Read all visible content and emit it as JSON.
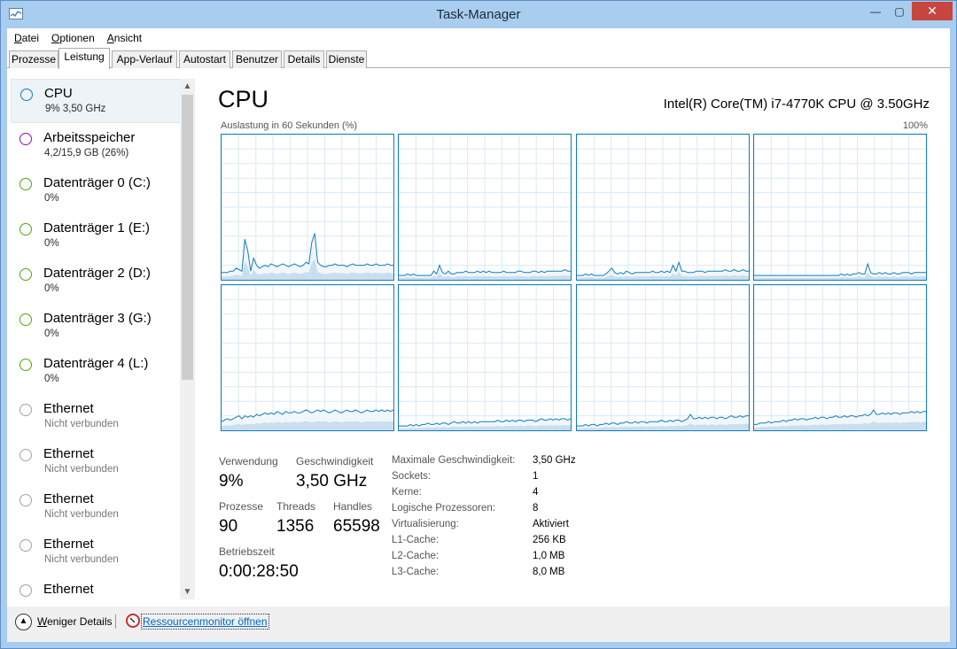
{
  "window": {
    "title": "Task-Manager"
  },
  "window_controls": {
    "minimize": "—",
    "maximize": "▢",
    "close": "✕"
  },
  "menu": [
    {
      "label": "Datei",
      "mnemonic": "D",
      "rest": "atei"
    },
    {
      "label": "Optionen",
      "mnemonic": "O",
      "rest": "ptionen"
    },
    {
      "label": "Ansicht",
      "mnemonic": "A",
      "rest": "nsicht"
    }
  ],
  "tabs": [
    "Prozesse",
    "Leistung",
    "App-Verlauf",
    "Autostart",
    "Benutzer",
    "Details",
    "Dienste"
  ],
  "active_tab": "Leistung",
  "sidebar": {
    "items": [
      {
        "title": "CPU",
        "sub": "9% 3,50 GHz",
        "color": "#117dbb",
        "selected": true
      },
      {
        "title": "Arbeitsspeicher",
        "sub": "4,2/15,9 GB (26%)",
        "color": "#8b12ae",
        "selected": false
      },
      {
        "title": "Datenträger 0 (C:)",
        "sub": "0%",
        "color": "#4da60c",
        "selected": false
      },
      {
        "title": "Datenträger 1 (E:)",
        "sub": "0%",
        "color": "#4da60c",
        "selected": false
      },
      {
        "title": "Datenträger 2 (D:)",
        "sub": "0%",
        "color": "#4da60c",
        "selected": false
      },
      {
        "title": "Datenträger 3 (G:)",
        "sub": "0%",
        "color": "#4da60c",
        "selected": false
      },
      {
        "title": "Datenträger 4 (L:)",
        "sub": "0%",
        "color": "#4da60c",
        "selected": false
      },
      {
        "title": "Ethernet",
        "sub": "Nicht verbunden",
        "color": "#a0a0a0",
        "selected": false
      },
      {
        "title": "Ethernet",
        "sub": "Nicht verbunden",
        "color": "#a0a0a0",
        "selected": false
      },
      {
        "title": "Ethernet",
        "sub": "Nicht verbunden",
        "color": "#a0a0a0",
        "selected": false
      },
      {
        "title": "Ethernet",
        "sub": "Nicht verbunden",
        "color": "#a0a0a0",
        "selected": false
      },
      {
        "title": "Ethernet",
        "sub": "",
        "color": "#a0a0a0",
        "selected": false
      }
    ]
  },
  "main": {
    "title": "CPU",
    "model": "Intel(R) Core(TM) i7-4770K CPU @ 3.50GHz",
    "graph_label": "Auslastung in 60 Sekunden (%)",
    "graph_max": "100%",
    "graph_color": "#117dbb"
  },
  "stats": {
    "usage_label": "Verwendung",
    "usage_value": "9%",
    "speed_label": "Geschwindigkeit",
    "speed_value": "3,50 GHz",
    "processes_label": "Prozesse",
    "processes_value": "90",
    "threads_label": "Threads",
    "threads_value": "1356",
    "handles_label": "Handles",
    "handles_value": "65598",
    "uptime_label": "Betriebszeit",
    "uptime_value": "0:00:28:50"
  },
  "specs": [
    {
      "label": "Maximale Geschwindigkeit:",
      "value": "3,50 GHz"
    },
    {
      "label": "Sockets:",
      "value": "1"
    },
    {
      "label": "Kerne:",
      "value": "4"
    },
    {
      "label": "Logische Prozessoren:",
      "value": "8"
    },
    {
      "label": "Virtualisierung:",
      "value": "Aktiviert"
    },
    {
      "label": "L1-Cache:",
      "value": "256 KB"
    },
    {
      "label": "L2-Cache:",
      "value": "1,0 MB"
    },
    {
      "label": "L3-Cache:",
      "value": "8,0 MB"
    }
  ],
  "footer": {
    "fewer_details": "Weniger Details",
    "fewer_mnemonic": "W",
    "fewer_rest": "eniger Details",
    "resource_monitor": "Ressourcenmonitor öffnen"
  }
}
